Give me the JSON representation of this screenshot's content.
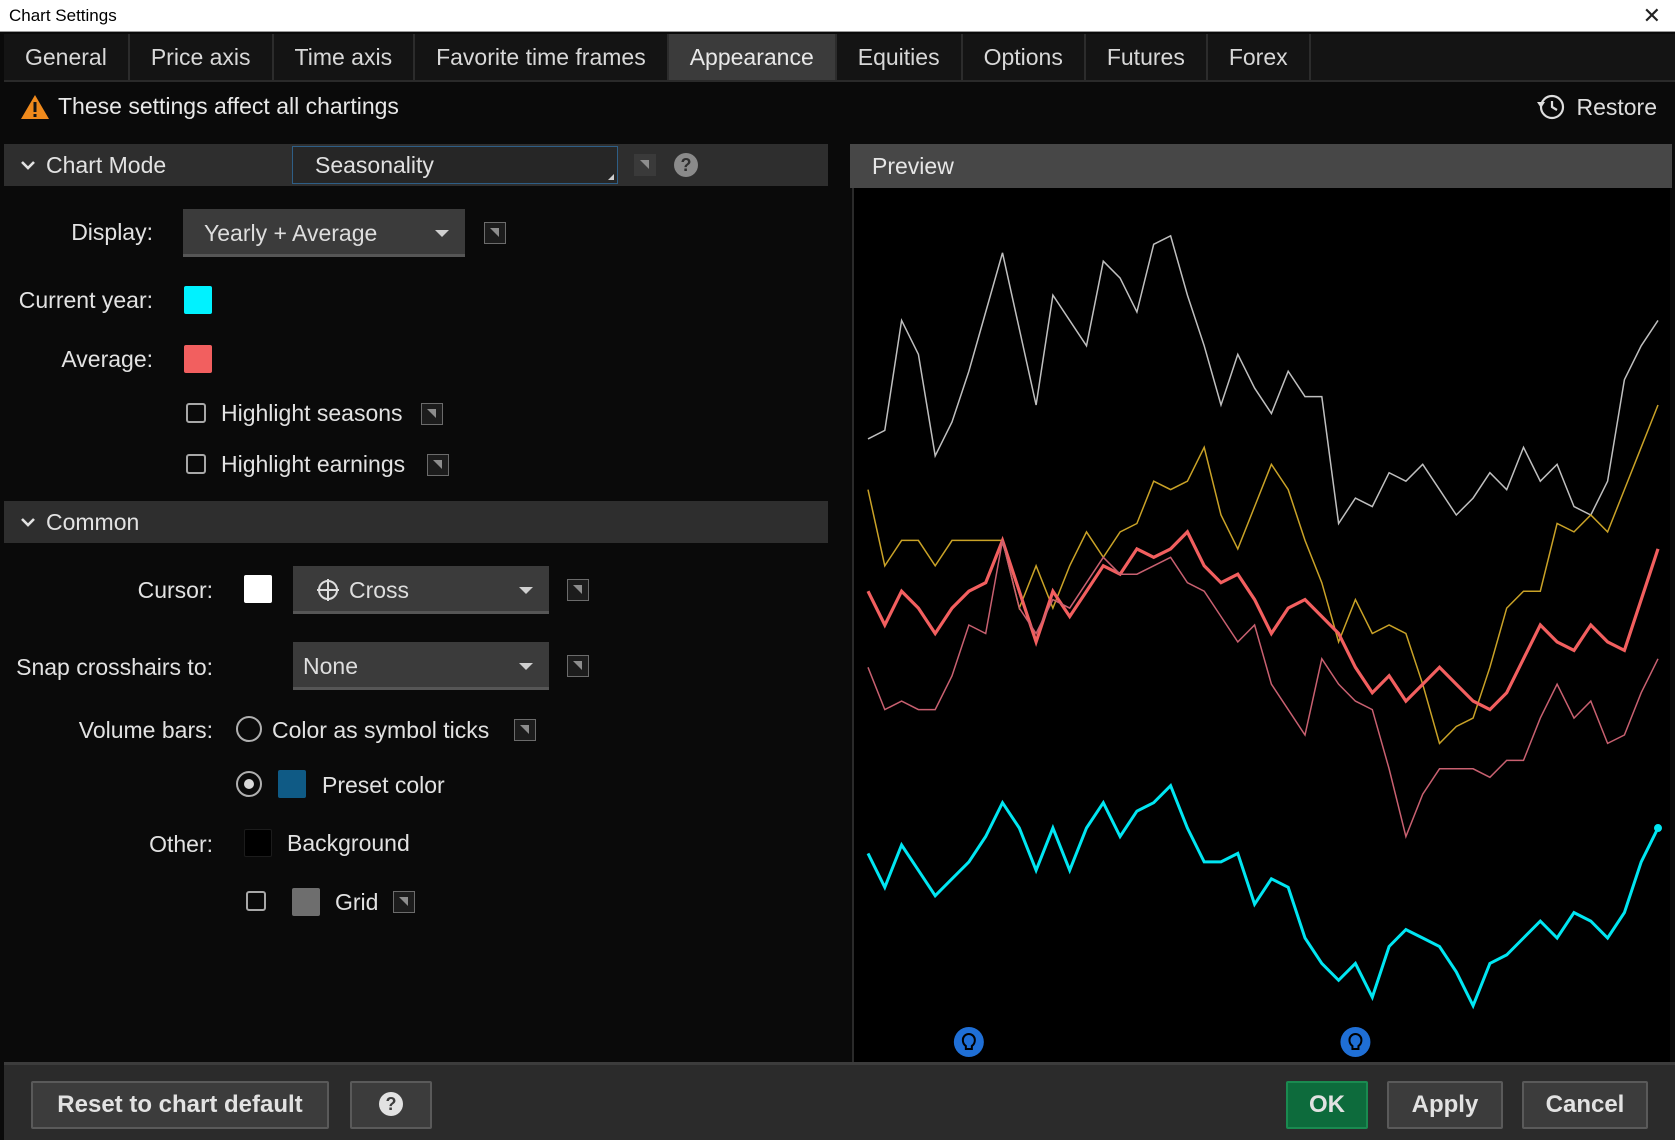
{
  "window": {
    "title": "Chart Settings",
    "close": "✕"
  },
  "tabs": [
    "General",
    "Price axis",
    "Time axis",
    "Favorite time frames",
    "Appearance",
    "Equities",
    "Options",
    "Futures",
    "Forex"
  ],
  "active_tab": "Appearance",
  "notice": "These settings affect all chartings",
  "restore_label": "Restore",
  "chart_mode": {
    "section_title": "Chart Mode",
    "mode_value": "Seasonality",
    "display_label": "Display:",
    "display_value": "Yearly + Average",
    "current_year_label": "Current year:",
    "current_year_color": "#00f2ff",
    "average_label": "Average:",
    "average_color": "#f25f5f",
    "highlight_seasons": "Highlight seasons",
    "highlight_earnings": "Highlight earnings"
  },
  "common": {
    "section_title": "Common",
    "cursor_label": "Cursor:",
    "cursor_color": "#ffffff",
    "cursor_value": "Cross",
    "snap_label": "Snap crosshairs to:",
    "snap_value": "None",
    "volume_label": "Volume bars:",
    "volume_opt1": "Color as symbol ticks",
    "volume_opt2": "Preset color",
    "preset_color": "#0f5a85",
    "other_label": "Other:",
    "background_label": "Background",
    "background_color": "#000000",
    "grid_label": "Grid",
    "grid_color": "#6e6e6e"
  },
  "preview_title": "Preview",
  "buttons": {
    "reset": "Reset to chart default",
    "help": "?",
    "ok": "OK",
    "apply": "Apply",
    "cancel": "Cancel"
  },
  "chart_data": {
    "type": "line",
    "x": [
      0,
      1,
      2,
      3,
      4,
      5,
      6,
      7,
      8,
      9,
      10,
      11,
      12,
      13,
      14,
      15,
      16,
      17,
      18,
      19,
      20,
      21,
      22,
      23,
      24,
      25,
      26,
      27,
      28,
      29,
      30,
      31,
      32,
      33,
      34,
      35,
      36,
      37,
      38,
      39,
      40,
      41,
      42,
      43,
      44,
      45,
      46,
      47
    ],
    "ylim": [
      0,
      100
    ],
    "series": [
      {
        "color": "#bfbfbf",
        "width": 1.5,
        "values": [
          72,
          73,
          86,
          82,
          70,
          74,
          80,
          87,
          94,
          85,
          76,
          89,
          86,
          83,
          93,
          91,
          87,
          95,
          96,
          89,
          83,
          76,
          82,
          78,
          75,
          80,
          77,
          77,
          62,
          65,
          64,
          68,
          67,
          69,
          66,
          63,
          65,
          68,
          66,
          71,
          67,
          69,
          64,
          63,
          67,
          79,
          83,
          86
        ]
      },
      {
        "color": "#c9a227",
        "width": 1.5,
        "values": [
          66,
          57,
          60,
          60,
          57,
          60,
          60,
          60,
          60,
          52,
          57,
          52,
          57,
          61,
          58,
          61,
          62,
          67,
          66,
          67,
          71,
          63,
          59,
          64,
          69,
          66,
          60,
          55,
          48,
          53,
          49,
          50,
          49,
          43,
          36,
          38,
          39,
          45,
          52,
          54,
          54,
          62,
          61,
          63,
          61,
          66,
          71,
          76
        ]
      },
      {
        "color": "#f25f5f",
        "width": 3.2,
        "values": [
          54,
          50,
          54,
          52,
          49,
          52,
          54,
          55,
          60,
          54,
          48,
          54,
          51,
          54,
          57,
          56,
          59,
          58,
          59,
          61,
          57,
          55,
          56,
          53,
          49,
          52,
          53,
          51,
          49,
          45,
          42,
          44,
          41,
          43,
          45,
          43,
          41,
          40,
          42,
          46,
          50,
          48,
          47,
          50,
          48,
          47,
          53,
          59
        ]
      },
      {
        "color": "#c86070",
        "width": 1.5,
        "values": [
          45,
          40,
          41,
          40,
          40,
          44,
          50,
          49,
          60,
          52,
          49,
          53,
          52,
          55,
          58,
          56,
          56,
          57,
          58,
          55,
          54,
          51,
          48,
          50,
          43,
          40,
          37,
          46,
          43,
          41,
          40,
          33,
          25,
          30,
          33,
          33,
          33,
          32,
          34,
          34,
          39,
          43,
          39,
          41,
          36,
          37,
          42,
          46
        ]
      },
      {
        "color": "#00e6f2",
        "width": 3.0,
        "values": [
          23,
          19,
          24,
          21,
          18,
          20,
          22,
          25,
          29,
          26,
          21,
          26,
          21,
          26,
          29,
          25,
          28,
          29,
          31,
          26,
          22,
          22,
          23,
          17,
          20,
          19,
          13,
          10,
          8,
          10,
          6,
          12,
          14,
          13,
          12,
          9,
          5,
          10,
          11,
          13,
          15,
          13,
          16,
          15,
          13,
          16,
          22,
          26
        ]
      }
    ],
    "earnings_markers_x": [
      6,
      29
    ]
  }
}
